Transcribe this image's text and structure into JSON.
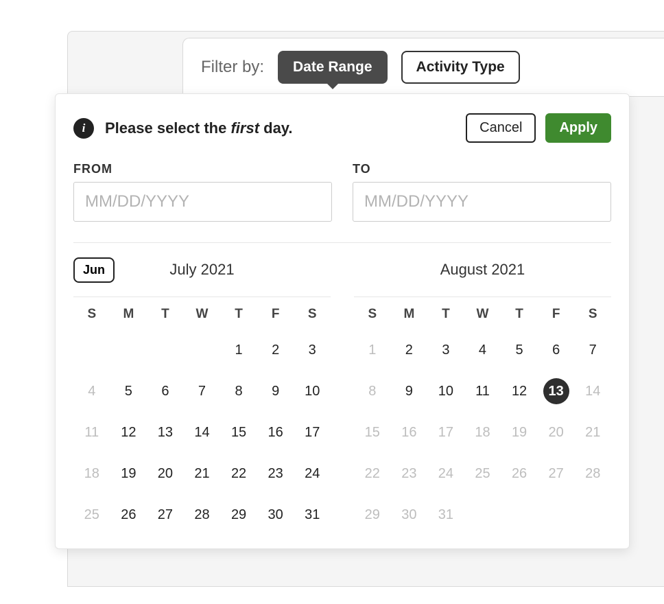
{
  "filter": {
    "label": "Filter by:",
    "date_range": "Date Range",
    "activity_type": "Activity Type"
  },
  "info": {
    "prefix": "Please select the ",
    "emph": "first",
    "suffix": " day."
  },
  "buttons": {
    "cancel": "Cancel",
    "apply": "Apply"
  },
  "fields": {
    "from_label": "FROM",
    "to_label": "TO",
    "placeholder": "MM/DD/YYYY"
  },
  "prev_month_label": "Jun",
  "dow": [
    "S",
    "M",
    "T",
    "W",
    "T",
    "F",
    "S"
  ],
  "months": [
    {
      "title": "July 2021",
      "lead_blank": 4,
      "days": [
        {
          "n": 1
        },
        {
          "n": 2
        },
        {
          "n": 3
        },
        {
          "n": 4,
          "muted": true
        },
        {
          "n": 5
        },
        {
          "n": 6
        },
        {
          "n": 7
        },
        {
          "n": 8
        },
        {
          "n": 9
        },
        {
          "n": 10
        },
        {
          "n": 11,
          "muted": true
        },
        {
          "n": 12
        },
        {
          "n": 13
        },
        {
          "n": 14
        },
        {
          "n": 15
        },
        {
          "n": 16
        },
        {
          "n": 17
        },
        {
          "n": 18,
          "muted": true
        },
        {
          "n": 19
        },
        {
          "n": 20
        },
        {
          "n": 21
        },
        {
          "n": 22
        },
        {
          "n": 23
        },
        {
          "n": 24
        },
        {
          "n": 25,
          "muted": true
        },
        {
          "n": 26
        },
        {
          "n": 27
        },
        {
          "n": 28
        },
        {
          "n": 29
        },
        {
          "n": 30
        },
        {
          "n": 31
        }
      ]
    },
    {
      "title": "August 2021",
      "lead_blank": 0,
      "days": [
        {
          "n": 1,
          "muted": true
        },
        {
          "n": 2
        },
        {
          "n": 3
        },
        {
          "n": 4
        },
        {
          "n": 5
        },
        {
          "n": 6
        },
        {
          "n": 7
        },
        {
          "n": 8,
          "muted": true
        },
        {
          "n": 9
        },
        {
          "n": 10
        },
        {
          "n": 11
        },
        {
          "n": 12
        },
        {
          "n": 13,
          "today": true
        },
        {
          "n": 14,
          "muted": true
        },
        {
          "n": 15,
          "muted": true
        },
        {
          "n": 16,
          "muted": true
        },
        {
          "n": 17,
          "muted": true
        },
        {
          "n": 18,
          "muted": true
        },
        {
          "n": 19,
          "muted": true
        },
        {
          "n": 20,
          "muted": true
        },
        {
          "n": 21,
          "muted": true
        },
        {
          "n": 22,
          "muted": true
        },
        {
          "n": 23,
          "muted": true
        },
        {
          "n": 24,
          "muted": true
        },
        {
          "n": 25,
          "muted": true
        },
        {
          "n": 26,
          "muted": true
        },
        {
          "n": 27,
          "muted": true
        },
        {
          "n": 28,
          "muted": true
        },
        {
          "n": 29,
          "muted": true
        },
        {
          "n": 30,
          "muted": true
        },
        {
          "n": 31,
          "muted": true
        }
      ]
    }
  ]
}
